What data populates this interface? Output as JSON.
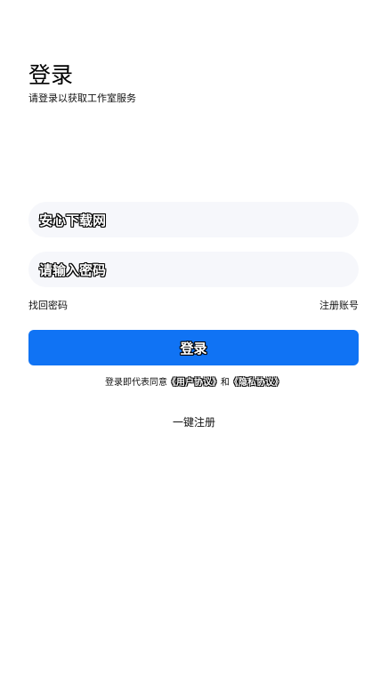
{
  "header": {
    "title": "登录",
    "subtitle": "请登录以获取工作室服务"
  },
  "form": {
    "username_value": "安心下载网",
    "password_placeholder": "请输入密码"
  },
  "links": {
    "forgot_password": "找回密码",
    "register_account": "注册账号"
  },
  "login_button": {
    "label": "登录",
    "color": "#1073f4"
  },
  "agreement": {
    "prefix": "登录即代表同意",
    "user_agreement": "《用户协议》",
    "conjunction": "和",
    "privacy_agreement": "《隐私协议》"
  },
  "one_click_register": "一键注册"
}
